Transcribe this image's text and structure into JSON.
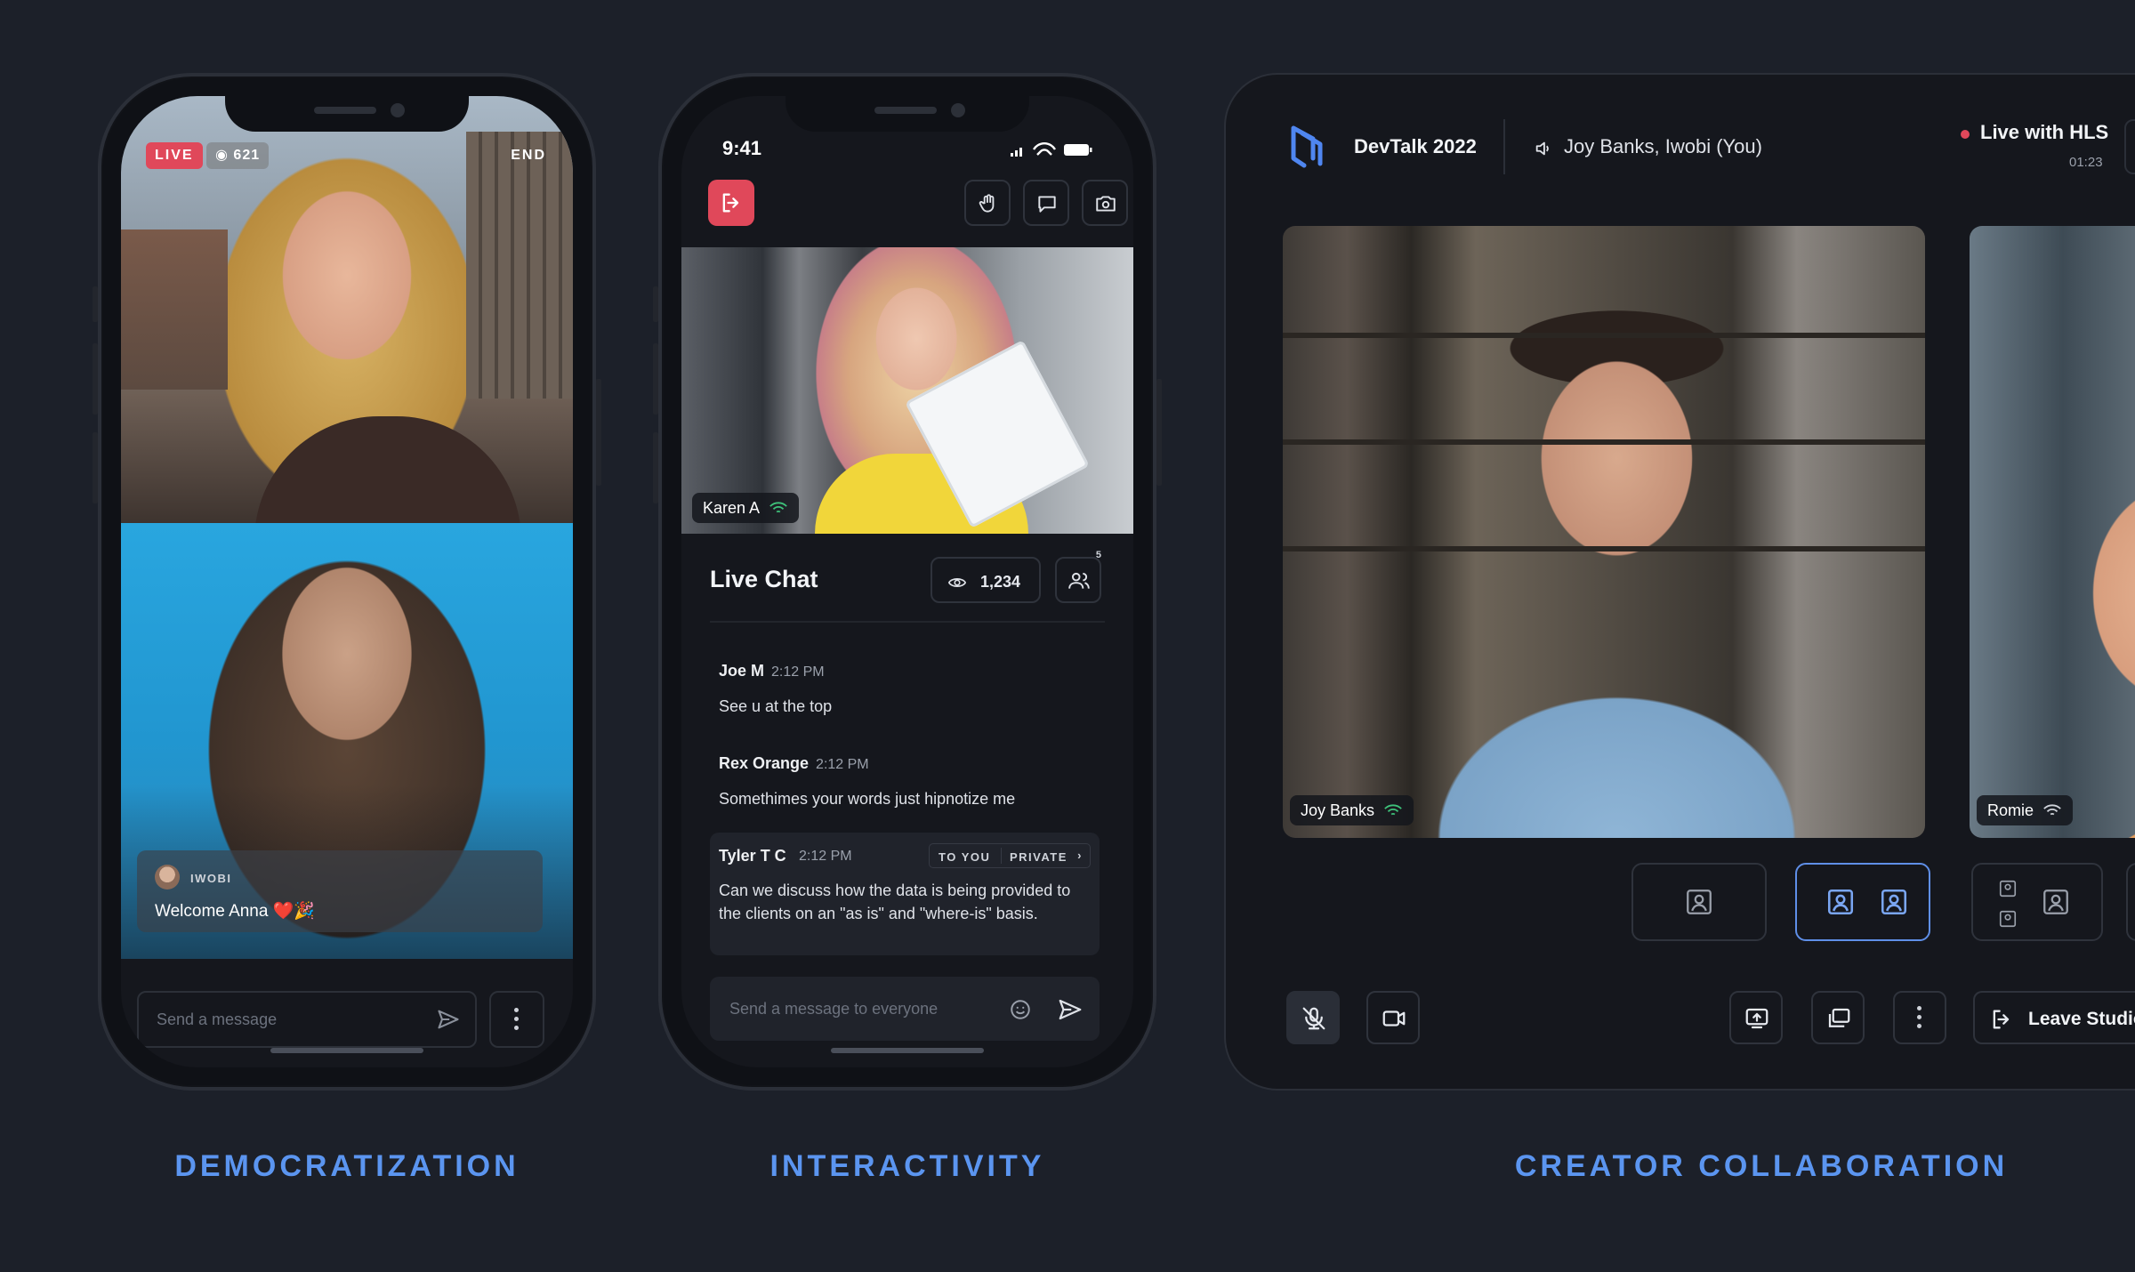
{
  "colors": {
    "background": "#1c2029",
    "accent_blue": "#5b95f0",
    "live_red": "#e0485a",
    "online_green": "#3ec27a"
  },
  "phone1": {
    "live_label": "LIVE",
    "viewer_count": "621",
    "end_label": "END",
    "chat": {
      "author": "IWOBI",
      "message": "Welcome Anna ❤️🎉"
    },
    "input_placeholder": "Send a message",
    "icons": [
      "eye-icon",
      "send-icon",
      "more-vertical-icon"
    ]
  },
  "phone2": {
    "status_time": "9:41",
    "video_name": "Karen A",
    "chat_title": "Live Chat",
    "view_count": "1,234",
    "participants_count": "5",
    "messages": [
      {
        "author": "Joe M",
        "time": "2:12 PM",
        "text": "See u at the top"
      },
      {
        "author": "Rex Orange",
        "time": "2:12 PM",
        "text": "Somethimes your words just hipnotize me"
      }
    ],
    "private_message": {
      "author": "Tyler T C",
      "time": "2:12 PM",
      "to_label": "TO YOU",
      "private_label": "PRIVATE",
      "chevron": "›",
      "text": "Can we discuss how the data is being provided to the clients on an \"as is\" and \"where-is\" basis."
    },
    "input_placeholder": "Send a message to everyone",
    "icons": [
      "leave-icon",
      "hand-raise-icon",
      "chat-icon",
      "switch-camera-icon",
      "eye-icon",
      "people-icon",
      "emoji-icon",
      "send-icon"
    ]
  },
  "studio": {
    "title": "DevTalk 2022",
    "speaking": "Joy Banks, Iwobi (You)",
    "live_label": "Live with HLS",
    "live_time": "01:23",
    "main_tile_name": "Joy Banks",
    "side_tile_name": "Romie",
    "leave_label": "Leave Studio",
    "icons": [
      "logo-icon",
      "speaker-icon",
      "mic-off-icon",
      "camera-icon",
      "share-screen-icon",
      "pip-icon",
      "more-vertical-icon",
      "leave-icon"
    ]
  },
  "captions": {
    "c1": "DEMOCRATIZATION",
    "c2": "INTERACTIVITY",
    "c3": "CREATOR COLLABORATION"
  }
}
